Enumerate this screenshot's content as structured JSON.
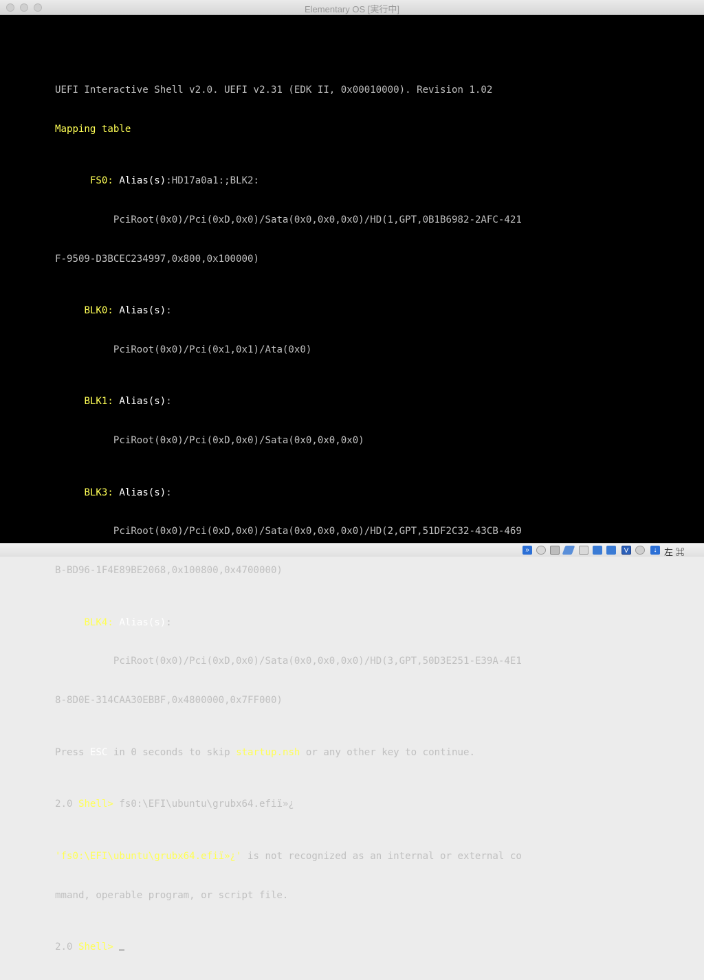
{
  "window": {
    "title": "Elementary OS [実行中]"
  },
  "terminal": {
    "header": "UEFI Interactive Shell v2.0. UEFI v2.31 (EDK II, 0x00010000). Revision 1.02",
    "mapping_title": "Mapping table",
    "fs0": {
      "label": "FS0:",
      "alias": "Alias(s)",
      "alias_value": ":HD17a0a1:;BLK2:",
      "path1": "PciRoot(0x0)/Pci(0xD,0x0)/Sata(0x0,0x0,0x0)/HD(1,GPT,0B1B6982-2AFC-421",
      "path2": "F-9509-D3BCEC234997,0x800,0x100000)"
    },
    "blk0": {
      "label": "BLK0:",
      "alias": "Alias(s)",
      "path1": "PciRoot(0x0)/Pci(0x1,0x1)/Ata(0x0)"
    },
    "blk1": {
      "label": "BLK1:",
      "alias": "Alias(s)",
      "path1": "PciRoot(0x0)/Pci(0xD,0x0)/Sata(0x0,0x0,0x0)"
    },
    "blk3": {
      "label": "BLK3:",
      "alias": "Alias(s)",
      "path1": "PciRoot(0x0)/Pci(0xD,0x0)/Sata(0x0,0x0,0x0)/HD(2,GPT,51DF2C32-43CB-469",
      "path2": "B-BD96-1F4E89BE2068,0x100800,0x4700000)"
    },
    "blk4": {
      "label": "BLK4:",
      "alias": "Alias(s)",
      "path1": "PciRoot(0x0)/Pci(0xD,0x0)/Sata(0x0,0x0,0x0)/HD(3,GPT,50D3E251-E39A-4E1",
      "path2": "8-8D0E-314CAA30EBBF,0x4800000,0x7FF000)"
    },
    "press": {
      "pre": "Press ",
      "esc": "ESC",
      "mid": " in 0 seconds to skip ",
      "startup": "startup.nsh",
      "post": " or any other key to continue."
    },
    "prompt_version": "2.0 ",
    "prompt_shell": "Shell>",
    "command": " fs0:\\EFI\\ubuntu\\grubx64.efiï»¿",
    "error": {
      "quoted": "'fs0:\\EFI\\ubuntu\\grubx64.efiï»¿'",
      "rest1": " is not recognized as an internal or external co",
      "rest2": "mmand, operable program, or script file."
    }
  },
  "statusbar": {
    "icons": [
      "storage-icon",
      "optical-icon",
      "audio-icon",
      "usb-icon",
      "shared-folder-icon",
      "display-icon",
      "network-icon",
      "video-capture-icon",
      "recording-icon",
      "mouse-integration-icon"
    ],
    "host_key": "左 ⌘"
  }
}
